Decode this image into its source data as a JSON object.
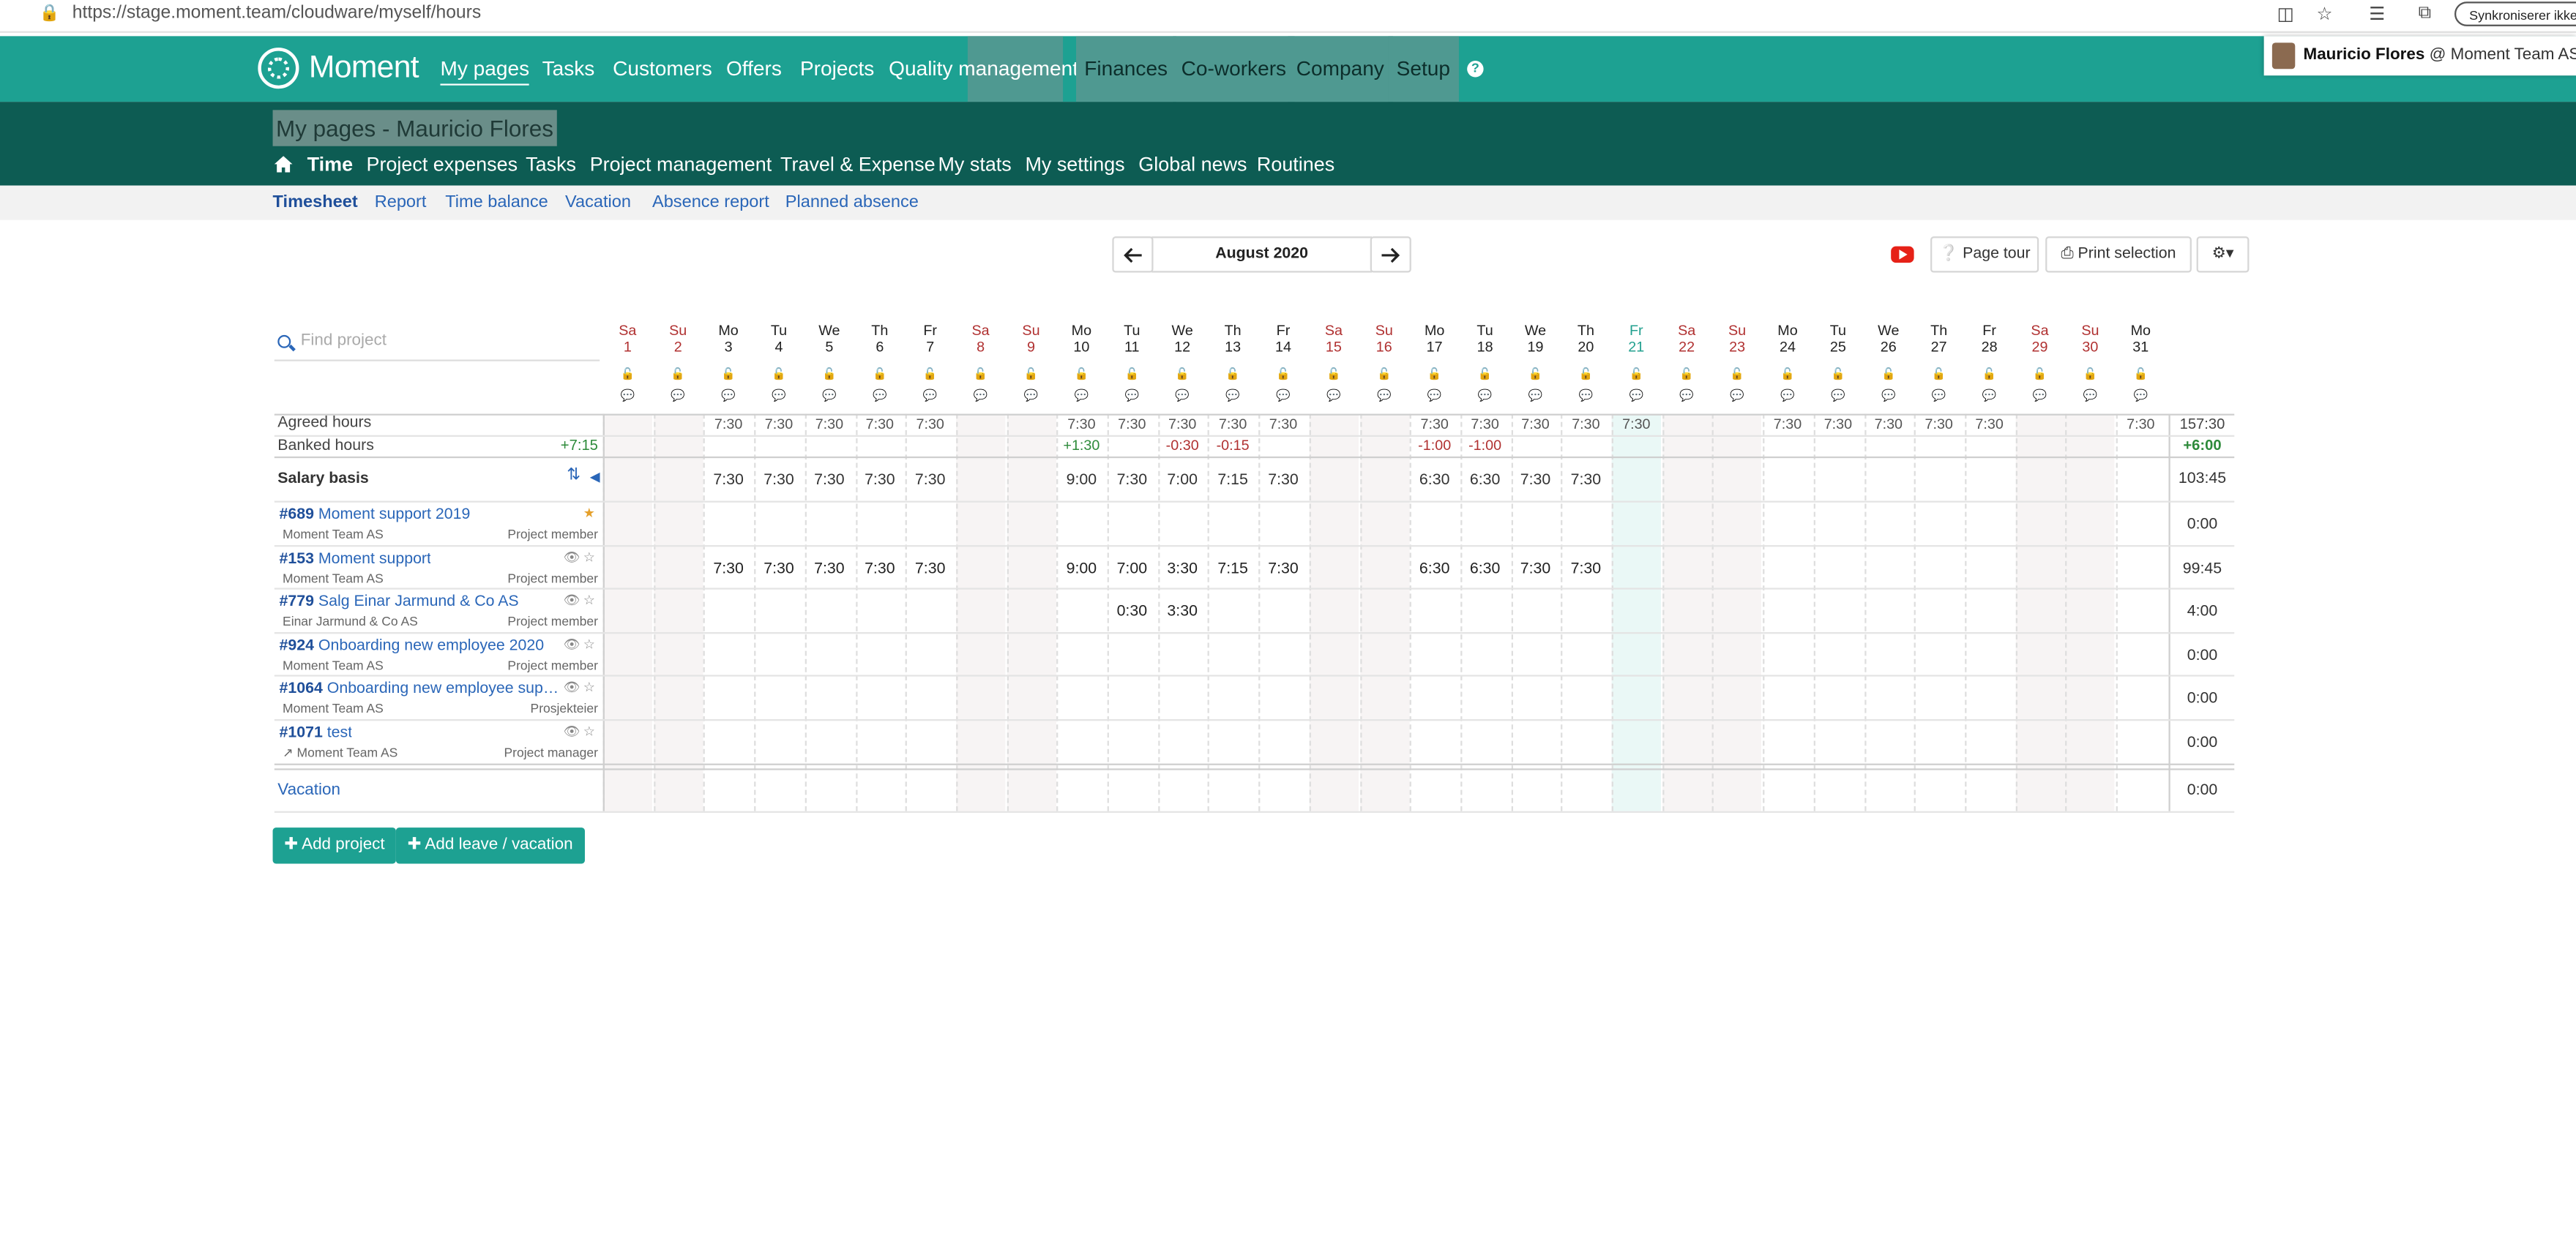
{
  "browser": {
    "url_host": "https://stage.moment.team",
    "url_path": "/cloudware/myself/hours",
    "sync_label": "Synkroniserer ikke"
  },
  "app": {
    "logo_text": "Moment",
    "top_nav": [
      "My pages",
      "Tasks",
      "Customers",
      "Offers",
      "Projects",
      "Quality management",
      "Finances",
      "Co-workers",
      "Company",
      "Setup"
    ],
    "help_icon": "?",
    "user": {
      "name": "Mauricio Flores",
      "company": "@ Moment Team AS"
    }
  },
  "page_title": "My pages - Mauricio Flores",
  "sub_nav": [
    "Time",
    "Project expenses",
    "Tasks",
    "Project management",
    "Travel & Expense",
    "My stats",
    "My settings",
    "Global news",
    "Routines"
  ],
  "tabs": [
    "Timesheet",
    "Report",
    "Time balance",
    "Vacation",
    "Absence report",
    "Planned absence"
  ],
  "toolbar": {
    "month": "August 2020",
    "prev_icon": "arrow-left-icon",
    "next_icon": "arrow-right-icon",
    "page_tour": "Page tour",
    "print_selection": "Print selection",
    "settings_icon": "gear-icon"
  },
  "search": {
    "placeholder": "Find project"
  },
  "days": [
    {
      "dow": "Sa",
      "num": "1"
    },
    {
      "dow": "Su",
      "num": "2"
    },
    {
      "dow": "Mo",
      "num": "3"
    },
    {
      "dow": "Tu",
      "num": "4"
    },
    {
      "dow": "We",
      "num": "5"
    },
    {
      "dow": "Th",
      "num": "6"
    },
    {
      "dow": "Fr",
      "num": "7"
    },
    {
      "dow": "Sa",
      "num": "8"
    },
    {
      "dow": "Su",
      "num": "9"
    },
    {
      "dow": "Mo",
      "num": "10"
    },
    {
      "dow": "Tu",
      "num": "11"
    },
    {
      "dow": "We",
      "num": "12"
    },
    {
      "dow": "Th",
      "num": "13"
    },
    {
      "dow": "Fr",
      "num": "14"
    },
    {
      "dow": "Sa",
      "num": "15"
    },
    {
      "dow": "Su",
      "num": "16"
    },
    {
      "dow": "Mo",
      "num": "17"
    },
    {
      "dow": "Tu",
      "num": "18"
    },
    {
      "dow": "We",
      "num": "19"
    },
    {
      "dow": "Th",
      "num": "20"
    },
    {
      "dow": "Fr",
      "num": "21"
    },
    {
      "dow": "Sa",
      "num": "22"
    },
    {
      "dow": "Su",
      "num": "23"
    },
    {
      "dow": "Mo",
      "num": "24"
    },
    {
      "dow": "Tu",
      "num": "25"
    },
    {
      "dow": "We",
      "num": "26"
    },
    {
      "dow": "Th",
      "num": "27"
    },
    {
      "dow": "Fr",
      "num": "28"
    },
    {
      "dow": "Sa",
      "num": "29"
    },
    {
      "dow": "Su",
      "num": "30"
    },
    {
      "dow": "Mo",
      "num": "31"
    }
  ],
  "today_index": 20,
  "rows": {
    "agreed": {
      "label": "Agreed hours",
      "values": [
        "",
        "",
        "7:30",
        "7:30",
        "7:30",
        "7:30",
        "7:30",
        "",
        "",
        "7:30",
        "7:30",
        "7:30",
        "7:30",
        "7:30",
        "",
        "",
        "7:30",
        "7:30",
        "7:30",
        "7:30",
        "7:30",
        "",
        "",
        "7:30",
        "7:30",
        "7:30",
        "7:30",
        "7:30",
        "",
        "",
        "7:30"
      ],
      "total": "157:30"
    },
    "banked": {
      "label": "Banked hours",
      "start": "+7:15",
      "values": [
        "",
        "",
        "",
        "",
        "",
        "",
        "",
        "",
        "",
        "+1:30",
        "",
        "-0:30",
        "-0:15",
        "",
        "",
        "",
        "-1:00",
        "-1:00",
        "",
        "",
        "",
        "",
        "",
        "",
        "",
        "",
        "",
        "",
        "",
        "",
        ""
      ],
      "total": "+6:00"
    },
    "salary": {
      "label": "Salary basis",
      "values": [
        "",
        "",
        "7:30",
        "7:30",
        "7:30",
        "7:30",
        "7:30",
        "",
        "",
        "9:00",
        "7:30",
        "7:00",
        "7:15",
        "7:30",
        "",
        "",
        "6:30",
        "6:30",
        "7:30",
        "7:30",
        "",
        "",
        "",
        "",
        "",
        "",
        "",
        "",
        "",
        "",
        ""
      ],
      "total": "103:45"
    }
  },
  "projects": [
    {
      "id": "#689",
      "name": "Moment support 2019",
      "company": "Moment Team AS",
      "role": "Project member",
      "starred": true,
      "hidden_toggle": false,
      "external": false,
      "values": [
        "",
        "",
        "",
        "",
        "",
        "",
        "",
        "",
        "",
        "",
        "",
        "",
        "",
        "",
        "",
        "",
        "",
        "",
        "",
        "",
        "",
        "",
        "",
        "",
        "",
        "",
        "",
        "",
        "",
        "",
        ""
      ],
      "total": "0:00"
    },
    {
      "id": "#153",
      "name": "Moment support",
      "company": "Moment Team AS",
      "role": "Project member",
      "starred": false,
      "hidden_toggle": true,
      "external": false,
      "values": [
        "",
        "",
        "7:30",
        "7:30",
        "7:30",
        "7:30",
        "7:30",
        "",
        "",
        "9:00",
        "7:00",
        "3:30",
        "7:15",
        "7:30",
        "",
        "",
        "6:30",
        "6:30",
        "7:30",
        "7:30",
        "",
        "",
        "",
        "",
        "",
        "",
        "",
        "",
        "",
        "",
        ""
      ],
      "total": "99:45"
    },
    {
      "id": "#779",
      "name": "Salg Einar Jarmund & Co AS",
      "company": "Einar Jarmund & Co AS",
      "role": "Project member",
      "starred": false,
      "hidden_toggle": true,
      "external": false,
      "values": [
        "",
        "",
        "",
        "",
        "",
        "",
        "",
        "",
        "",
        "",
        "0:30",
        "3:30",
        "",
        "",
        "",
        "",
        "",
        "",
        "",
        "",
        "",
        "",
        "",
        "",
        "",
        "",
        "",
        "",
        "",
        "",
        ""
      ],
      "total": "4:00"
    },
    {
      "id": "#924",
      "name": "Onboarding new employee 2020",
      "company": "Moment Team AS",
      "role": "Project member",
      "starred": false,
      "hidden_toggle": true,
      "external": false,
      "values": [
        "",
        "",
        "",
        "",
        "",
        "",
        "",
        "",
        "",
        "",
        "",
        "",
        "",
        "",
        "",
        "",
        "",
        "",
        "",
        "",
        "",
        "",
        "",
        "",
        "",
        "",
        "",
        "",
        "",
        "",
        ""
      ],
      "total": "0:00"
    },
    {
      "id": "#1064",
      "name": "Onboarding new employee support ...",
      "company": "Moment Team AS",
      "role": "Prosjekteier",
      "starred": false,
      "hidden_toggle": true,
      "external": false,
      "values": [
        "",
        "",
        "",
        "",
        "",
        "",
        "",
        "",
        "",
        "",
        "",
        "",
        "",
        "",
        "",
        "",
        "",
        "",
        "",
        "",
        "",
        "",
        "",
        "",
        "",
        "",
        "",
        "",
        "",
        "",
        ""
      ],
      "total": "0:00"
    },
    {
      "id": "#1071",
      "name": "test",
      "company": "Moment Team AS",
      "role": "Project manager",
      "starred": false,
      "hidden_toggle": true,
      "external": true,
      "values": [
        "",
        "",
        "",
        "",
        "",
        "",
        "",
        "",
        "",
        "",
        "",
        "",
        "",
        "",
        "",
        "",
        "",
        "",
        "",
        "",
        "",
        "",
        "",
        "",
        "",
        "",
        "",
        "",
        "",
        "",
        ""
      ],
      "total": "0:00"
    }
  ],
  "vacation_row": {
    "label": "Vacation",
    "total": "0:00"
  },
  "buttons": {
    "add_project": "Add project",
    "add_leave": "Add leave / vacation"
  },
  "colors": {
    "brand": "#1da192",
    "brand_dark": "#0d5c53",
    "link": "#2a66b8",
    "weekend": "#b03030",
    "positive": "#2d8a3a"
  }
}
